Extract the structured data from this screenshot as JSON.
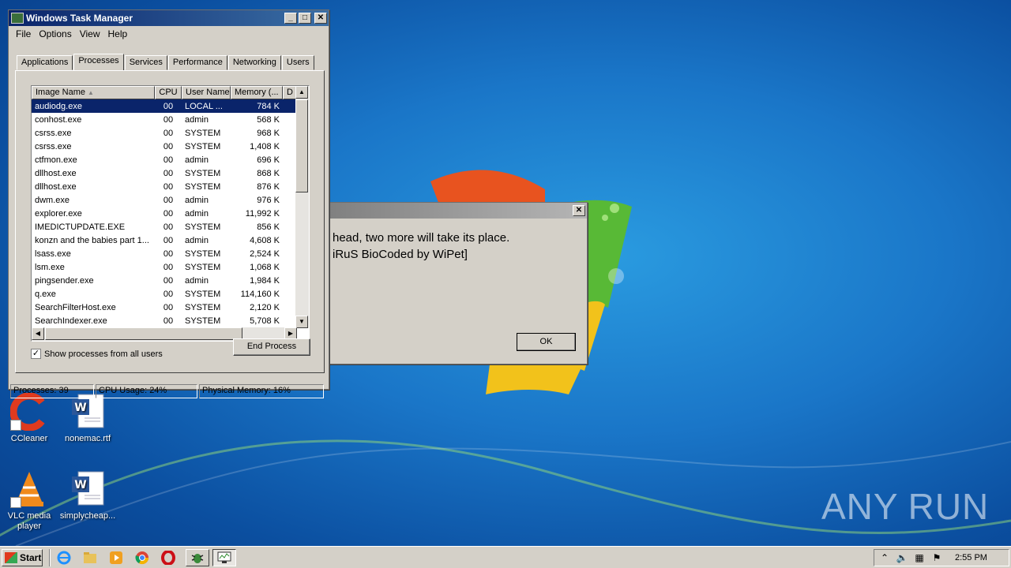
{
  "taskmgr": {
    "title": "Windows Task Manager",
    "menu": [
      "File",
      "Options",
      "View",
      "Help"
    ],
    "tabs": [
      "Applications",
      "Processes",
      "Services",
      "Performance",
      "Networking",
      "Users"
    ],
    "active_tab": "Processes",
    "columns": [
      "Image Name",
      "CPU",
      "User Name",
      "Memory (...",
      "D"
    ],
    "processes": [
      {
        "name": "audiodg.exe",
        "cpu": "00",
        "user": "LOCAL ...",
        "mem": "784 K"
      },
      {
        "name": "conhost.exe",
        "cpu": "00",
        "user": "admin",
        "mem": "568 K"
      },
      {
        "name": "csrss.exe",
        "cpu": "00",
        "user": "SYSTEM",
        "mem": "968 K"
      },
      {
        "name": "csrss.exe",
        "cpu": "00",
        "user": "SYSTEM",
        "mem": "1,408 K"
      },
      {
        "name": "ctfmon.exe",
        "cpu": "00",
        "user": "admin",
        "mem": "696 K"
      },
      {
        "name": "dllhost.exe",
        "cpu": "00",
        "user": "SYSTEM",
        "mem": "868 K"
      },
      {
        "name": "dllhost.exe",
        "cpu": "00",
        "user": "SYSTEM",
        "mem": "876 K"
      },
      {
        "name": "dwm.exe",
        "cpu": "00",
        "user": "admin",
        "mem": "976 K"
      },
      {
        "name": "explorer.exe",
        "cpu": "00",
        "user": "admin",
        "mem": "11,992 K"
      },
      {
        "name": "IMEDICTUPDATE.EXE",
        "cpu": "00",
        "user": "SYSTEM",
        "mem": "856 K"
      },
      {
        "name": "konzn and the babies part 1...",
        "cpu": "00",
        "user": "admin",
        "mem": "4,608 K"
      },
      {
        "name": "lsass.exe",
        "cpu": "00",
        "user": "SYSTEM",
        "mem": "2,524 K"
      },
      {
        "name": "lsm.exe",
        "cpu": "00",
        "user": "SYSTEM",
        "mem": "1,068 K"
      },
      {
        "name": "pingsender.exe",
        "cpu": "00",
        "user": "admin",
        "mem": "1,984 K"
      },
      {
        "name": "q.exe",
        "cpu": "00",
        "user": "SYSTEM",
        "mem": "114,160 K"
      },
      {
        "name": "SearchFilterHost.exe",
        "cpu": "00",
        "user": "SYSTEM",
        "mem": "2,120 K"
      },
      {
        "name": "SearchIndexer.exe",
        "cpu": "00",
        "user": "SYSTEM",
        "mem": "5,708 K"
      }
    ],
    "show_all_label": "Show processes from all users",
    "show_all_checked": true,
    "end_process_label": "End Process",
    "status": {
      "processes": "Processes: 39",
      "cpu": "CPU Usage: 24%",
      "memory": "Physical Memory: 16%"
    }
  },
  "message_box": {
    "line1": "head, two more will take its place.",
    "line2": "iRuS BioCoded by WiPet]",
    "ok_label": "OK"
  },
  "desktop_icons": [
    {
      "label": "CCleaner",
      "icon": "ccleaner-icon"
    },
    {
      "label": "nonemac.rtf",
      "icon": "word-document-icon"
    },
    {
      "label": "VLC media player",
      "icon": "vlc-icon"
    },
    {
      "label": "simplycheap...",
      "icon": "word-document-icon"
    }
  ],
  "taskbar": {
    "start_label": "Start",
    "clock": "2:55 PM"
  },
  "watermark": {
    "left": "ANY",
    "right": "RUN"
  }
}
